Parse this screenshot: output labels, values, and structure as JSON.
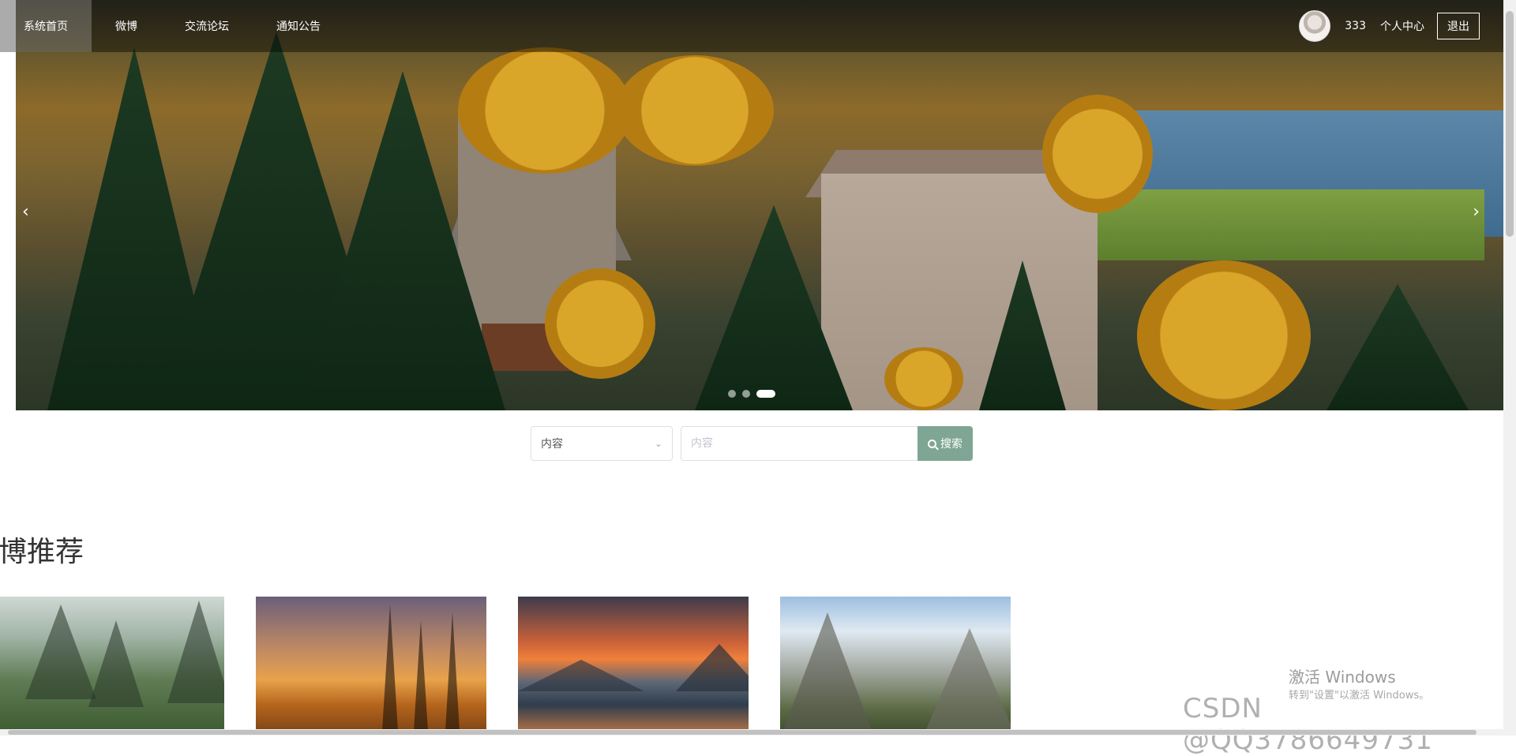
{
  "nav": {
    "items": [
      {
        "label": "系统首页",
        "active": true
      },
      {
        "label": "微博",
        "active": false
      },
      {
        "label": "交流论坛",
        "active": false
      },
      {
        "label": "通知公告",
        "active": false
      }
    ],
    "username": "333",
    "personal_center": "个人中心",
    "logout": "退出"
  },
  "banner": {
    "prev_icon": "‹",
    "next_icon": "›",
    "slide_count": 3,
    "active_slide": 3
  },
  "search": {
    "select_value": "内容",
    "input_placeholder": "内容",
    "button_label": "搜索",
    "button_color": "#7fa595"
  },
  "section": {
    "title": "博推荐"
  },
  "watermarks": {
    "windows_title": "激活 Windows",
    "windows_sub": "转到\"设置\"以激活 Windows。",
    "csdn": "CSDN @QQ3786649731"
  }
}
